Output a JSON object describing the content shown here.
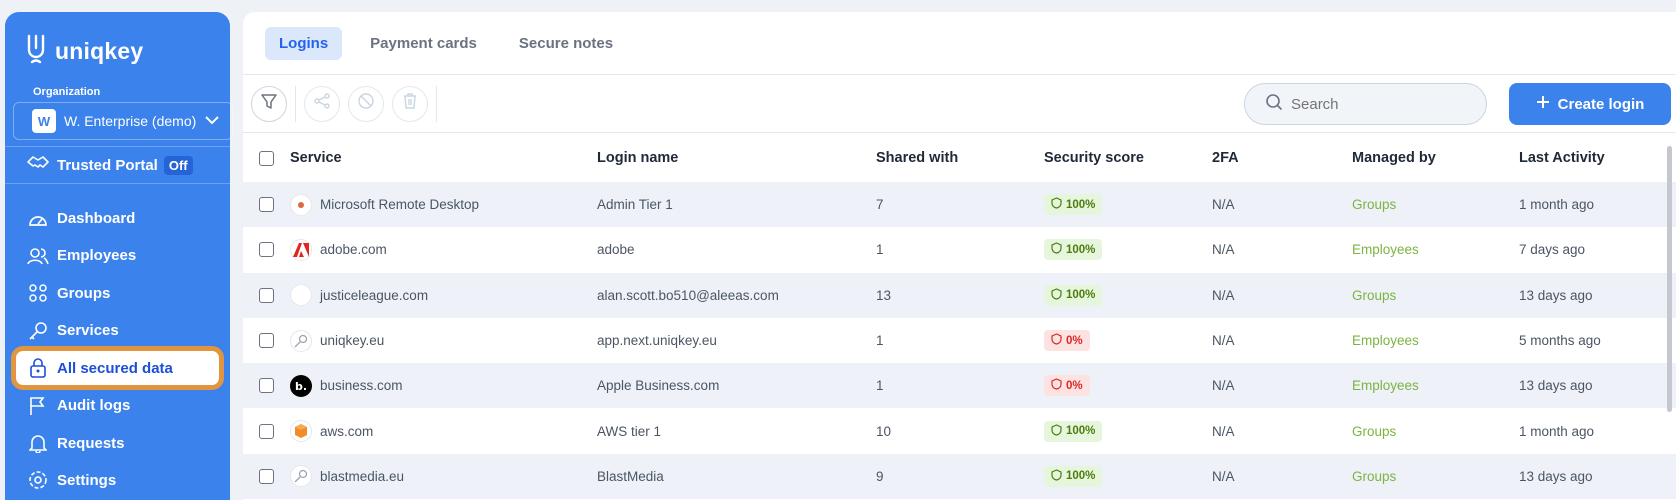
{
  "app": {
    "brand": "uniqkey"
  },
  "sidebar": {
    "org_label": "Organization",
    "org_badge": "W",
    "org_name": "W. Enterprise (demo)",
    "portal_label": "Trusted Portal",
    "portal_status": "Off",
    "items": [
      {
        "label": "Dashboard",
        "icon": "gauge-icon"
      },
      {
        "label": "Employees",
        "icon": "users-icon"
      },
      {
        "label": "Groups",
        "icon": "groups-icon"
      },
      {
        "label": "Services",
        "icon": "key-icon"
      },
      {
        "label": "All secured data",
        "icon": "lock-icon",
        "active": true
      },
      {
        "label": "Audit logs",
        "icon": "flag-icon"
      },
      {
        "label": "Requests",
        "icon": "bell-icon"
      },
      {
        "label": "Settings",
        "icon": "gear-icon"
      }
    ]
  },
  "tabs": [
    {
      "label": "Logins",
      "active": true
    },
    {
      "label": "Payment cards"
    },
    {
      "label": "Secure notes"
    }
  ],
  "toolbar": {
    "search_placeholder": "Search",
    "create_label": "Create login"
  },
  "table": {
    "headers": [
      "Service",
      "Login name",
      "Shared with",
      "Security score",
      "2FA",
      "Managed by",
      "Last Activity"
    ],
    "rows": [
      {
        "service": "Microsoft Remote Desktop",
        "login": "Admin Tier 1",
        "shared": "7",
        "score": "100%",
        "good": true,
        "twofa": "N/A",
        "managed": "Groups",
        "activity": "1 month ago",
        "icon": "remote-desktop-icon"
      },
      {
        "service": "adobe.com",
        "login": "adobe",
        "shared": "1",
        "score": "100%",
        "good": true,
        "twofa": "N/A",
        "managed": "Employees",
        "activity": "7 days ago",
        "icon": "adobe-icon"
      },
      {
        "service": "justiceleague.com",
        "login": "alan.scott.bo510@aleeas.com",
        "shared": "13",
        "score": "100%",
        "good": true,
        "twofa": "N/A",
        "managed": "Groups",
        "activity": "13 days ago",
        "icon": "blank-icon"
      },
      {
        "service": "uniqkey.eu",
        "login": "app.next.uniqkey.eu",
        "shared": "1",
        "score": "0%",
        "good": false,
        "twofa": "N/A",
        "managed": "Employees",
        "activity": "5 months ago",
        "icon": "key-icon"
      },
      {
        "service": "business.com",
        "login": "Apple Business.com",
        "shared": "1",
        "score": "0%",
        "good": false,
        "twofa": "N/A",
        "managed": "Employees",
        "activity": "13 days ago",
        "icon": "business-icon"
      },
      {
        "service": "aws.com",
        "login": "AWS tier 1",
        "shared": "10",
        "score": "100%",
        "good": true,
        "twofa": "N/A",
        "managed": "Groups",
        "activity": "1 month ago",
        "icon": "aws-icon"
      },
      {
        "service": "blastmedia.eu",
        "login": "BlastMedia",
        "shared": "9",
        "score": "100%",
        "good": true,
        "twofa": "N/A",
        "managed": "Groups",
        "activity": "13 days ago",
        "icon": "key-icon"
      }
    ]
  },
  "colors": {
    "brand": "#3b82ec",
    "highlight": "#e0953e",
    "good": "#4d7c0f",
    "bad": "#dc2626",
    "managed": "#7cb342"
  }
}
